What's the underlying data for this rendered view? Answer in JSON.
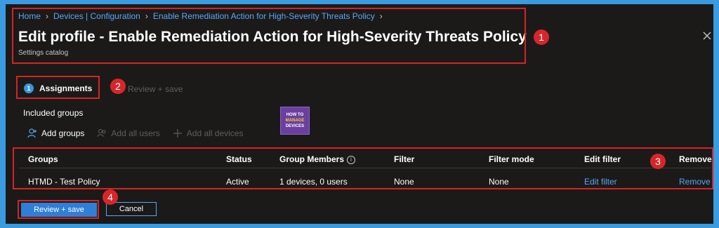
{
  "breadcrumb": {
    "items": [
      "Home",
      "Devices | Configuration",
      "Enable Remediation Action for High-Severity Threats Policy"
    ],
    "separator": ">"
  },
  "header": {
    "title": "Edit profile - Enable Remediation Action for High-Severity Threats Policy",
    "subtitle": "Settings catalog",
    "close_icon": "close-icon"
  },
  "tabs": [
    {
      "step": "1",
      "label": "Assignments",
      "active": true
    },
    {
      "label": "Review + save",
      "active": false
    }
  ],
  "logo": {
    "line1": "HOW TO",
    "line2": "MANAGE",
    "line3": "DEVICES"
  },
  "included_groups_label": "Included groups",
  "toolbar": {
    "add_groups": "Add groups",
    "add_all_users": "Add all users",
    "add_all_devices": "Add all devices"
  },
  "table": {
    "columns": [
      "Groups",
      "Status",
      "Group Members",
      "Filter",
      "Filter mode",
      "Edit filter",
      "Remove"
    ],
    "rows": [
      {
        "group": "HTMD - Test Policy",
        "status": "Active",
        "members": "1 devices, 0 users",
        "filter": "None",
        "filter_mode": "None",
        "edit_filter": "Edit filter",
        "remove": "Remove"
      }
    ]
  },
  "footer": {
    "review_save": "Review + save",
    "cancel": "Cancel"
  },
  "callouts": [
    "1",
    "2",
    "3",
    "4"
  ],
  "colors": {
    "accent": "#5aa7f2",
    "primary_button": "#2f7fd6",
    "callout": "#d7262b",
    "background": "#1b1a19"
  }
}
